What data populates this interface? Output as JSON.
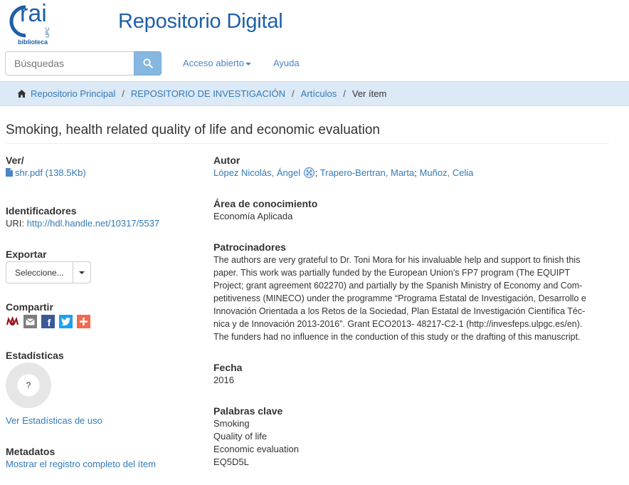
{
  "header": {
    "logo_text": "rai",
    "logo_sub": "biblioteca",
    "logo_upc": "UPC",
    "site_title": "Repositorio Digital"
  },
  "search": {
    "placeholder": "Búsquedas",
    "icon": "search-icon"
  },
  "nav": {
    "open_access": "Acceso abierto",
    "help": "Ayuda"
  },
  "breadcrumb": {
    "home": "Repositorio Principal",
    "collection": "REPOSITORIO DE INVESTIGACIÓN",
    "subcollection": "Artículos",
    "current": "Ver ítem",
    "separator": "/"
  },
  "item": {
    "title": "Smoking, health related quality of life and economic evaluation"
  },
  "left": {
    "view_heading": "Ver/",
    "file_link": "shr.pdf (138.5Kb)",
    "identifiers_heading": "Identificadores",
    "uri_label": "URI:",
    "uri_link": "http://hdl.handle.net/10317/5537",
    "export_heading": "Exportar",
    "export_select": "Seleccione...",
    "share_heading": "Compartir",
    "stats_heading": "Estadísticas",
    "stats_value": "?",
    "stats_link": "Ver Estadísticas de uso",
    "metadata_heading": "Metadatos",
    "metadata_link": "Mostrar el registro completo del ítem"
  },
  "right": {
    "author_heading": "Autor",
    "authors": [
      "López Nicolás, Ángel",
      "Trapero-Bertran, Marta",
      "Muñoz, Celia"
    ],
    "author_sep": ";",
    "area_heading": "Área de conocimiento",
    "area": "Economía Aplicada",
    "sponsors_heading": "Patrocinadores",
    "sponsors_lines": [
      "The authors are very grateful to Dr. Toni Mora for his invaluable help and support to finish this",
      "paper. This work was partially funded by the European Union’s FP7 program (The EQUIPT",
      "Project; grant agreement 602270) and partially by the Spanish Ministry of Economy and Com-",
      "petitiveness (MINECO) under the programme “Programa Estatal de Investigación, Desarrollo e",
      "Innovación Orientada a los Retos de la Sociedad, Plan Estatal de Investigación Científica Téc-",
      "nica y de Innovación 2013-2016”. Grant ECO2013- 48217-C2-1 (http://invesfeps.ulpgc.es/en).",
      "The funders had no influence in the conduction of this study or the drafting of this manuscript."
    ],
    "date_heading": "Fecha",
    "date": "2016",
    "keywords_heading": "Palabras clave",
    "keywords": [
      "Smoking",
      "Quality of life",
      "Economic evaluation",
      "EQ5D5L"
    ]
  },
  "colors": {
    "link": "#337ab7",
    "title_blue": "#1f5fa8",
    "breadcrumb_bg": "#dce9f6",
    "search_button": "#85b7e0"
  }
}
